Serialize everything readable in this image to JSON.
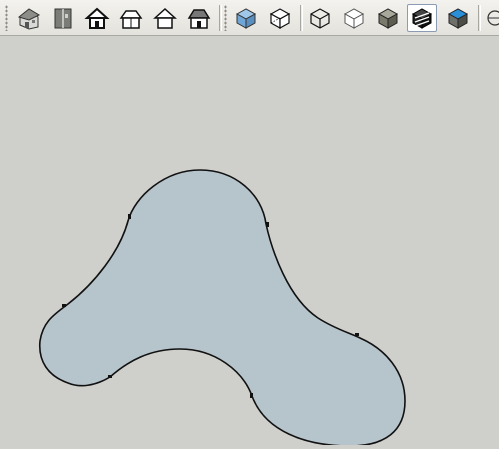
{
  "toolbar": {
    "views": [
      {
        "name": "iso-view-icon"
      },
      {
        "name": "top-view-icon"
      },
      {
        "name": "front-view-icon"
      },
      {
        "name": "right-view-icon"
      },
      {
        "name": "back-view-icon"
      },
      {
        "name": "left-view-icon"
      }
    ],
    "styles": [
      {
        "name": "xray-style-icon"
      },
      {
        "name": "back-edges-style-icon"
      },
      {
        "name": "wireframe-style-icon"
      },
      {
        "name": "hidden-line-style-icon"
      },
      {
        "name": "shaded-style-icon"
      },
      {
        "name": "shaded-textures-style-icon",
        "active": true
      },
      {
        "name": "monochrome-style-icon"
      }
    ]
  },
  "viewport": {
    "shape": "curved-face",
    "face_color": "#b6c4cb",
    "edge_color": "#111111",
    "background_color": "#cfcfcb"
  }
}
